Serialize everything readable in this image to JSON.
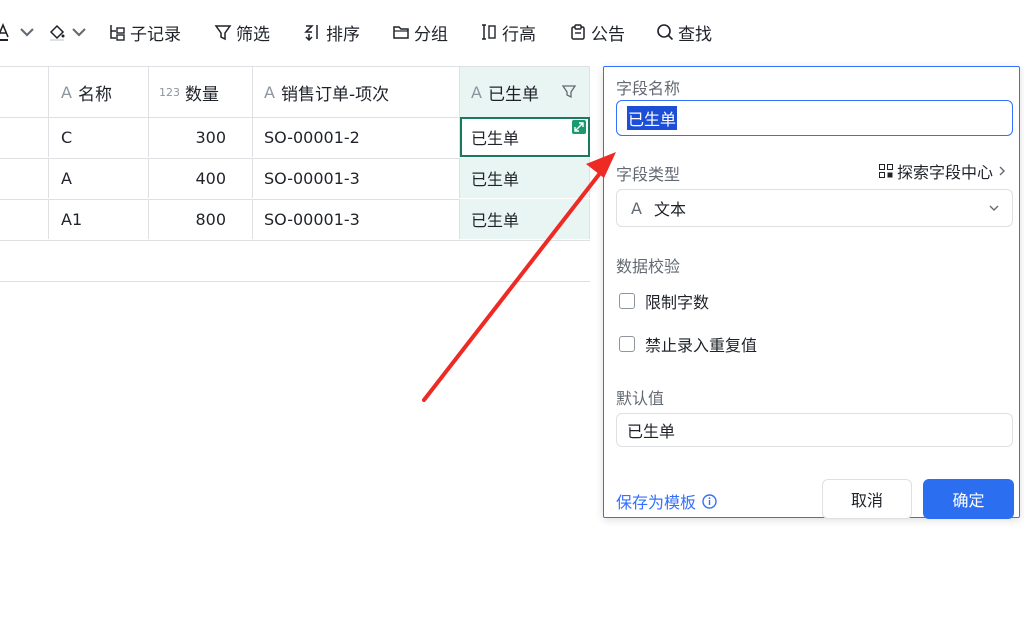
{
  "toolbar": {
    "subrecord": "子记录",
    "filter": "筛选",
    "sort": "排序",
    "group": "分组",
    "row_height": "行高",
    "notice": "公告",
    "find": "查找"
  },
  "table": {
    "headers": {
      "name": "名称",
      "qty_icon": "123",
      "qty": "数量",
      "order": "销售订单-项次",
      "status": "已生单"
    },
    "type_icon": "A",
    "rows": [
      {
        "name": "C",
        "qty": "300",
        "order": "SO-00001-2",
        "status": "已生单"
      },
      {
        "name": "A",
        "qty": "400",
        "order": "SO-00001-3",
        "status": "已生单"
      },
      {
        "name": "A1",
        "qty": "800",
        "order": "SO-00001-3",
        "status": "已生单"
      }
    ]
  },
  "panel": {
    "field_name_label": "字段名称",
    "field_name_value": "已生单",
    "field_type_label": "字段类型",
    "explore_label": "探索字段中心",
    "type_value": "文本",
    "validation_label": "数据校验",
    "limit_chars": "限制字数",
    "no_duplicates": "禁止录入重复值",
    "default_label": "默认值",
    "default_value": "已生单",
    "save_template": "保存为模板",
    "cancel": "取消",
    "confirm": "确定"
  },
  "colors": {
    "accent": "#3370ff",
    "primary_button": "#2b6ff0",
    "column_highlight": "#e8f5f2",
    "selection_border": "#1a7a5e",
    "arrow": "#ee2a24"
  }
}
